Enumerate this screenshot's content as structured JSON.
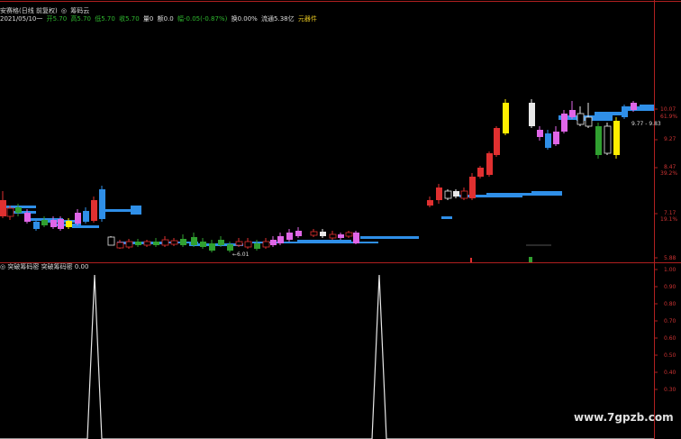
{
  "header": {
    "title": "安赛格(日线 前复权)",
    "chip_icon": "circle-icon",
    "chip_label": "筹码云",
    "date": "2021/05/10一",
    "open_label": "开",
    "open": "5.70",
    "high_label": "高",
    "high": "5.70",
    "low_label": "低",
    "low": "5.70",
    "close_label": "收",
    "close": "5.70",
    "vol_label": "量",
    "vol": "0",
    "amt_label": "额",
    "amt": "0.0",
    "chg_label": "幅",
    "chg": "-0.05(-0.87%)",
    "turn_label": "换",
    "turn": "0.00%",
    "float_label": "流通",
    "float": "5.38亿",
    "sector": "元器件"
  },
  "sub_header": {
    "icon": "circle-icon",
    "indicator_name": "突破筹码密",
    "series_label": "突破筹码密",
    "value": "0.00"
  },
  "price_axis": {
    "labels": [
      "10.07",
      "61.9%",
      "9.27",
      "8.47",
      "39.2%",
      "7.17",
      "19.1%",
      "5.88"
    ],
    "colors": {
      "price": "#cc3333",
      "pct": "#cc3333"
    }
  },
  "sub_axis": {
    "labels": [
      "1.00",
      "0.90",
      "0.80",
      "0.70",
      "0.60",
      "0.50",
      "0.40",
      "0.30"
    ]
  },
  "annotations": {
    "tooltip": "9.77 - 9.83",
    "low_marker": "←6.01"
  },
  "watermark": "www.7gpzb.com",
  "colors": {
    "up": "#e03030",
    "down": "#30a030",
    "chip": "#2f8fe8",
    "magenta": "#e066e8",
    "yellow": "#ffee00",
    "panel_border": "#b02020"
  }
}
